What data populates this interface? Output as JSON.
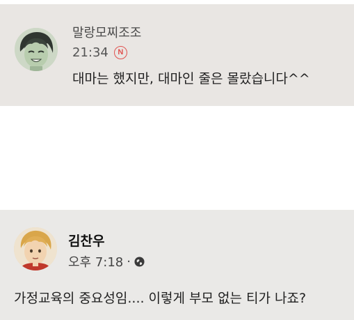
{
  "comment": {
    "author": "말랑모찌조조",
    "time": "21:34",
    "badge": "N",
    "text": "대마는 했지만, 대마인 줄은 몰랐습니다^^",
    "avatar_icon": "profile-avatar"
  },
  "post": {
    "author": "김찬우",
    "time": "오후 7:18",
    "separator": "·",
    "privacy_icon": "globe-icon",
    "text": "가정교육의 중요성임.... 이렇게 부모 없는 티가 나죠?",
    "avatar_icon": "profile-avatar"
  },
  "colors": {
    "top_card_bg": "#e9e6e3",
    "bottom_card_bg": "#eae9e7",
    "badge_red": "#e0524f"
  }
}
